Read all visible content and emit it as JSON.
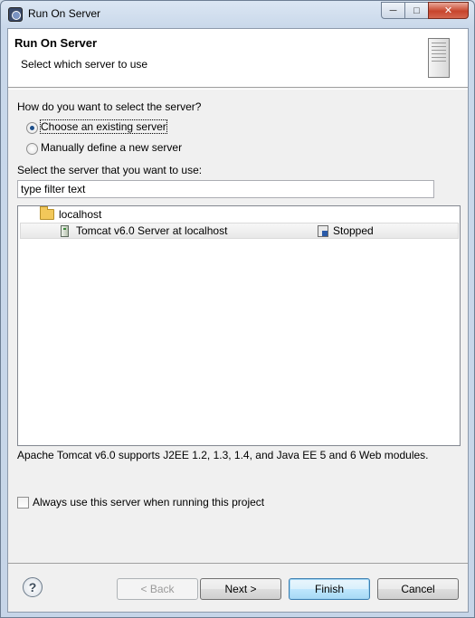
{
  "window": {
    "title": "Run On Server",
    "minimize": "─",
    "maximize": "□",
    "close": "✕"
  },
  "header": {
    "title": "Run On Server",
    "subtitle": "Select which server to use"
  },
  "question": "How do you want to select the server?",
  "options": [
    {
      "label": "Choose an existing server",
      "checked": true
    },
    {
      "label": "Manually define a new server",
      "checked": false
    }
  ],
  "filter": {
    "label": "Select the server that you want to use:",
    "value": "type filter text"
  },
  "tree": {
    "host": "localhost",
    "servers": [
      {
        "name": "Tomcat v6.0 Server at localhost",
        "state": "Stopped"
      }
    ]
  },
  "description": "Apache Tomcat v6.0 supports J2EE 1.2, 1.3, 1.4, and Java EE 5 and 6 Web modules.",
  "always_use": {
    "label": "Always use this server when running this project",
    "checked": false
  },
  "buttons": {
    "help": "?",
    "back": "< Back",
    "next": "Next >",
    "finish": "Finish",
    "cancel": "Cancel"
  }
}
